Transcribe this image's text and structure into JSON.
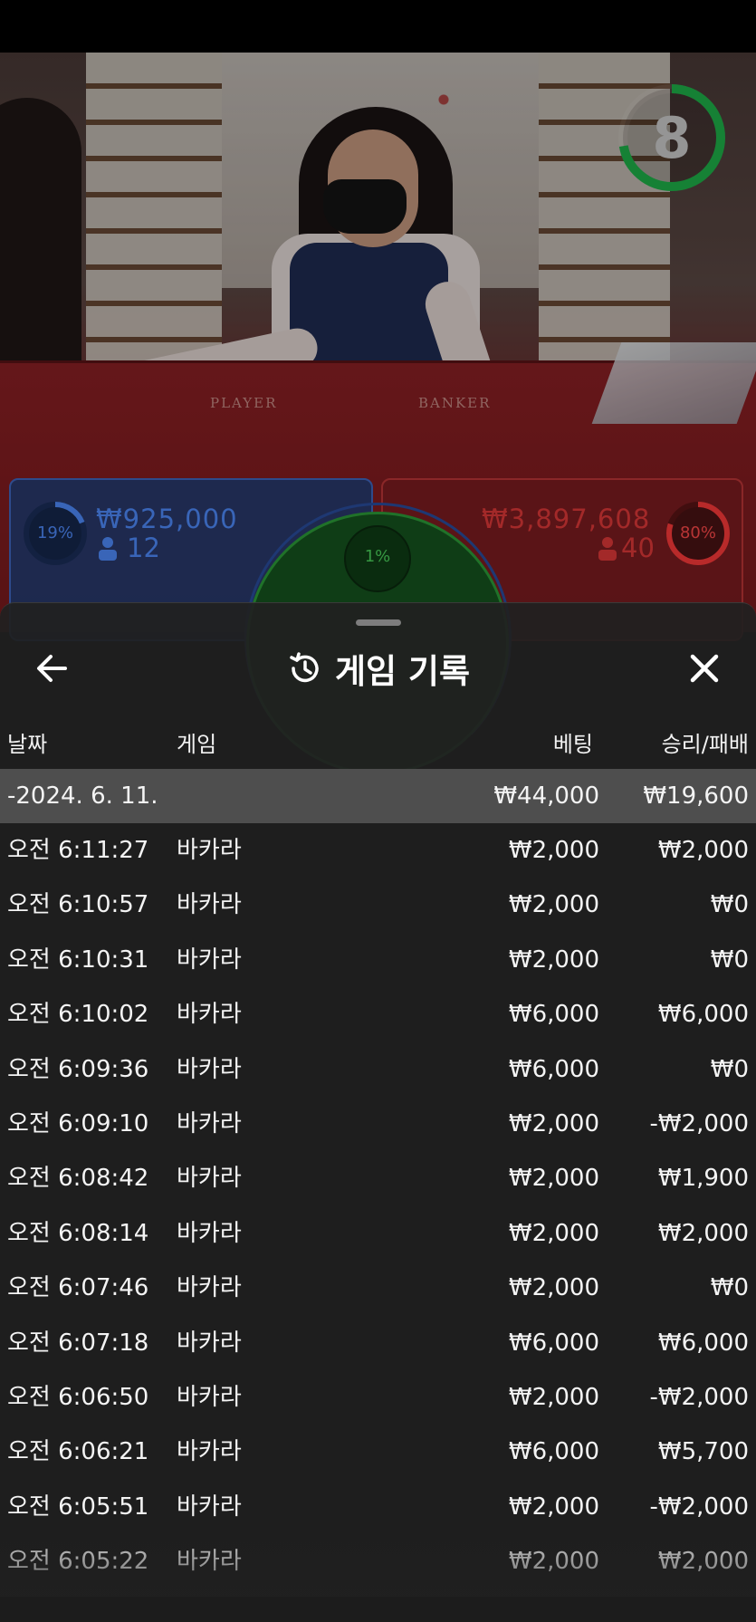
{
  "game_view": {
    "countdown": "8",
    "felt_player": "PLAYER",
    "felt_banker": "BANKER",
    "player": {
      "percent": "19%",
      "amount": "₩925,000",
      "bettors": "12"
    },
    "tie": {
      "percent": "1%"
    },
    "banker": {
      "percent": "80%",
      "amount": "₩3,897,608",
      "bettors": "40"
    }
  },
  "history": {
    "title": "게임 기록",
    "icons": {
      "back": "arrow-left-icon",
      "title": "history-icon",
      "close": "close-icon"
    },
    "columns": {
      "date": "날짜",
      "game": "게임",
      "bet": "베팅",
      "win_loss": "승리/패배"
    },
    "summary": {
      "date": "-2024. 6. 11.",
      "bet": "₩44,000",
      "win_loss": "₩19,600"
    },
    "rows": [
      {
        "time": "오전 6:11:27",
        "game": "바카라",
        "bet": "₩2,000",
        "result": "₩2,000"
      },
      {
        "time": "오전 6:10:57",
        "game": "바카라",
        "bet": "₩2,000",
        "result": "₩0"
      },
      {
        "time": "오전 6:10:31",
        "game": "바카라",
        "bet": "₩2,000",
        "result": "₩0"
      },
      {
        "time": "오전 6:10:02",
        "game": "바카라",
        "bet": "₩6,000",
        "result": "₩6,000"
      },
      {
        "time": "오전 6:09:36",
        "game": "바카라",
        "bet": "₩6,000",
        "result": "₩0"
      },
      {
        "time": "오전 6:09:10",
        "game": "바카라",
        "bet": "₩2,000",
        "result": "-₩2,000"
      },
      {
        "time": "오전 6:08:42",
        "game": "바카라",
        "bet": "₩2,000",
        "result": "₩1,900"
      },
      {
        "time": "오전 6:08:14",
        "game": "바카라",
        "bet": "₩2,000",
        "result": "₩2,000"
      },
      {
        "time": "오전 6:07:46",
        "game": "바카라",
        "bet": "₩2,000",
        "result": "₩0"
      },
      {
        "time": "오전 6:07:18",
        "game": "바카라",
        "bet": "₩6,000",
        "result": "₩6,000"
      },
      {
        "time": "오전 6:06:50",
        "game": "바카라",
        "bet": "₩2,000",
        "result": "-₩2,000"
      },
      {
        "time": "오전 6:06:21",
        "game": "바카라",
        "bet": "₩6,000",
        "result": "₩5,700"
      },
      {
        "time": "오전 6:05:51",
        "game": "바카라",
        "bet": "₩2,000",
        "result": "-₩2,000"
      },
      {
        "time": "오전 6:05:22",
        "game": "바카라",
        "bet": "₩2,000",
        "result": "₩2,000"
      }
    ]
  },
  "colors": {
    "player_blue": "#3b6fd0",
    "banker_red": "#c43a3a",
    "tie_green": "#2d9e3a",
    "timer_green": "#1fb34a",
    "sheet_bg": "#202020"
  }
}
